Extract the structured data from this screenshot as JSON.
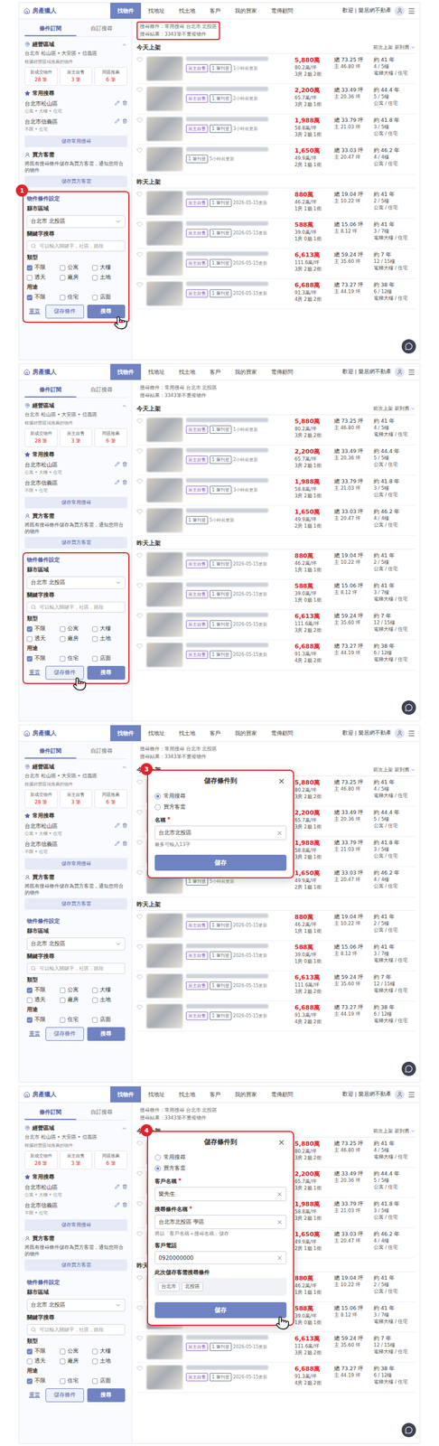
{
  "app": {
    "logo": "房產獵人",
    "nav": [
      {
        "label": "找物件",
        "selected": true
      },
      {
        "label": "找地址",
        "selected": false
      },
      {
        "label": "找土地",
        "selected": false
      },
      {
        "label": "客戶",
        "selected": false
      },
      {
        "label": "我的買家",
        "selected": false
      },
      {
        "label": "電傳顧問",
        "selected": false
      }
    ],
    "welcome": "歡迎 | 樂居網不動產"
  },
  "sidebar": {
    "tabs": [
      {
        "label": "條件訂閱",
        "selected": true
      },
      {
        "label": "自訂搜尋",
        "selected": false
      }
    ],
    "area": {
      "title": "經營區域",
      "value": "台北市 松山區 • 大安區 • 信義區",
      "note": "根據經營區域推薦的物件",
      "expanded": true,
      "stats": [
        {
          "label": "新成交物件",
          "count": "28 筆"
        },
        {
          "label": "屋主自售",
          "count": "3 筆"
        },
        {
          "label": "同區推薦",
          "count": "6 筆"
        }
      ]
    },
    "saved": {
      "title": "常用搜尋",
      "items": [
        {
          "name": "台北市松山區",
          "desc": "公寓 • 大樓 • 住宅"
        },
        {
          "name": "台北市信義區",
          "desc": "不限 • 住宅"
        }
      ],
      "button": "儲存常用搜尋"
    },
    "buyer": {
      "title": "買方客需",
      "desc": "將既有搜尋條件儲存為買方客需，通知您符合的物件",
      "button": "儲存買方客需"
    },
    "filter": {
      "title": "物件條件設定",
      "region_label": "縣市區域",
      "region_value": "台北市 北投區",
      "keyword_label": "關鍵字搜尋",
      "keyword_placeholder": "可以輸入關鍵字，社區，路段",
      "type_label": "類型",
      "types": [
        {
          "label": "不限",
          "checked": true
        },
        {
          "label": "公寓",
          "checked": false
        },
        {
          "label": "大樓",
          "checked": false
        },
        {
          "label": "透天",
          "checked": false
        },
        {
          "label": "廠房",
          "checked": false
        },
        {
          "label": "土地",
          "checked": false
        }
      ],
      "use_label": "用途",
      "uses": [
        {
          "label": "不限",
          "checked": true
        },
        {
          "label": "住宅",
          "checked": false
        },
        {
          "label": "店面",
          "checked": false
        }
      ],
      "reset": "重置",
      "save": "儲存條件",
      "search": "搜尋"
    }
  },
  "results": {
    "breadcrumb": "搜尋條件：常用搜尋 台北市 北投區",
    "count": "搜尋結果：3343筆不重複物件",
    "sort": "前次上架 新到舊",
    "groups": [
      {
        "title": "今天上架",
        "listings": [
          {
            "price": "5,880萬",
            "unit": "80.2萬/坪",
            "rooms": "3房 2廳 2衛",
            "area": "總 73.25 坪",
            "main": "主 46.80 坪",
            "age": "約 41 年",
            "floor": "4 / 5樓",
            "type": "電梯大樓 / 住宅",
            "tags": [
              {
                "label": "屋主自售",
                "color": "#8e63c9"
              },
              {
                "label": "1 筆刊登",
                "color": "#6b7280"
              }
            ],
            "updated": "1小時前更新"
          },
          {
            "price": "2,200萬",
            "unit": "65.7萬/坪",
            "rooms": "3房 2廳 1衛",
            "area": "總 33.49 坪",
            "main": "主 20.36 坪",
            "age": "約 44.4 年",
            "floor": "5 / 5樓",
            "type": "公寓 / 住宅",
            "tags": [
              {
                "label": "屋主自售",
                "color": "#8e63c9"
              },
              {
                "label": "1 筆刊登",
                "color": "#6b7280"
              }
            ],
            "updated": "2小時前更新"
          },
          {
            "price": "1,988萬",
            "unit": "58.8萬/坪",
            "rooms": "3房 2廳 1衛",
            "area": "總 33.79 坪",
            "main": "主 21.03 坪",
            "age": "約 41.8 年",
            "floor": "3 / 5樓",
            "type": "公寓 / 住宅",
            "tags": [
              {
                "label": "屋主自售",
                "color": "#8e63c9"
              },
              {
                "label": "1 筆刊登",
                "color": "#6b7280"
              }
            ],
            "updated": "3小時前更新"
          },
          {
            "price": "1,650萬",
            "unit": "49.9萬/坪",
            "rooms": "2房 1廳 1衛",
            "area": "總 33.03 坪",
            "main": "主 20.47 坪",
            "age": "約 46.2 年",
            "floor": "4 / 4樓",
            "type": "公寓 / 住宅",
            "tags": [
              {
                "label": "1 筆刊登",
                "color": "#6b7280"
              }
            ],
            "updated": "5小時前更新"
          }
        ]
      },
      {
        "title": "昨天上架",
        "listings": [
          {
            "price": "880萬",
            "unit": "46.2萬/坪",
            "rooms": "1房 1廳 1衛",
            "area": "總 19.04 坪",
            "main": "主 10.22 坪",
            "age": "約 41 年",
            "floor": "2 / 5樓",
            "type": "公寓 / 住宅",
            "tags": [
              {
                "label": "屋主自售",
                "color": "#8e63c9"
              },
              {
                "label": "1 筆刊登",
                "color": "#6b7280"
              }
            ],
            "updated": "2026-05-15更新"
          },
          {
            "price": "588萬",
            "unit": "39.0萬/坪",
            "rooms": "1房 0廳 1衛",
            "area": "總 15.06 坪",
            "main": "主 8.12 坪",
            "age": "約 41 年",
            "floor": "3 / 7樓",
            "type": "電梯大樓 / 住宅",
            "tags": [
              {
                "label": "屋主自售",
                "color": "#8e63c9"
              },
              {
                "label": "1 筆刊登",
                "color": "#6b7280"
              }
            ],
            "updated": "2026-05-15更新"
          },
          {
            "price": "6,613萬",
            "unit": "111.6萬/坪",
            "rooms": "3房 2廳 2衛",
            "area": "總 59.24 坪",
            "main": "主 35.60 坪",
            "age": "約 7 年",
            "floor": "12 / 15樓",
            "type": "電梯大樓 / 住宅",
            "tags": [
              {
                "label": "屋主自售",
                "color": "#8e63c9"
              },
              {
                "label": "1 筆刊登",
                "color": "#6b7280"
              }
            ],
            "updated": "2026-05-15更新"
          },
          {
            "price": "6,688萬",
            "unit": "91.3萬/坪",
            "rooms": "4房 2廳 2衛",
            "area": "總 73.27 坪",
            "main": "主 44.19 坪",
            "age": "約 38 年",
            "floor": "6 / 12樓",
            "type": "電梯大樓 / 住宅",
            "tags": [
              {
                "label": "屋主自售",
                "color": "#8e63c9"
              },
              {
                "label": "1 筆刊登",
                "color": "#6b7280"
              }
            ],
            "updated": "2026-05-15更新"
          }
        ]
      }
    ]
  },
  "steps": [
    {
      "badge": "1",
      "breadcrumb_highlighted": true,
      "filter_highlighted": true,
      "pointer": "search",
      "modal": null
    },
    {
      "badge": null,
      "breadcrumb_highlighted": false,
      "filter_highlighted": true,
      "pointer": "save",
      "modal": null
    },
    {
      "badge": "3",
      "breadcrumb_highlighted": false,
      "filter_highlighted": false,
      "pointer": null,
      "modal": {
        "title": "儲存條件到",
        "highlighted": true,
        "required_mark": "*",
        "options": [
          {
            "label": "常用搜尋",
            "selected": true
          },
          {
            "label": "買方客需",
            "selected": false
          }
        ],
        "fields": [
          {
            "label": "名稱",
            "required": true,
            "value": "台北市北投區",
            "hint": "最多可輸入13字"
          }
        ],
        "summary": null,
        "button": "儲存",
        "pointer_on_button": false
      }
    },
    {
      "badge": "4",
      "breadcrumb_highlighted": false,
      "filter_highlighted": false,
      "pointer": null,
      "modal": {
        "title": "儲存條件到",
        "highlighted": true,
        "required_mark": "*",
        "options": [
          {
            "label": "常用搜尋",
            "selected": false
          },
          {
            "label": "買方客需",
            "selected": true
          }
        ],
        "fields": [
          {
            "label": "客戶名稱",
            "required": true,
            "value": "樂先生",
            "hint": null
          },
          {
            "label": "搜尋條件名稱",
            "required": true,
            "value": "台北市北投區 學區",
            "hint": "將以「客戶名稱＋搜尋名稱」儲存"
          },
          {
            "label": "客戶電話",
            "required": false,
            "value": "0920000000",
            "hint": null
          }
        ],
        "summary": {
          "label": "此次儲存客需搜尋條件",
          "chips": [
            "台北市",
            "北投區"
          ]
        },
        "button": "儲存",
        "pointer_on_button": true
      }
    }
  ]
}
